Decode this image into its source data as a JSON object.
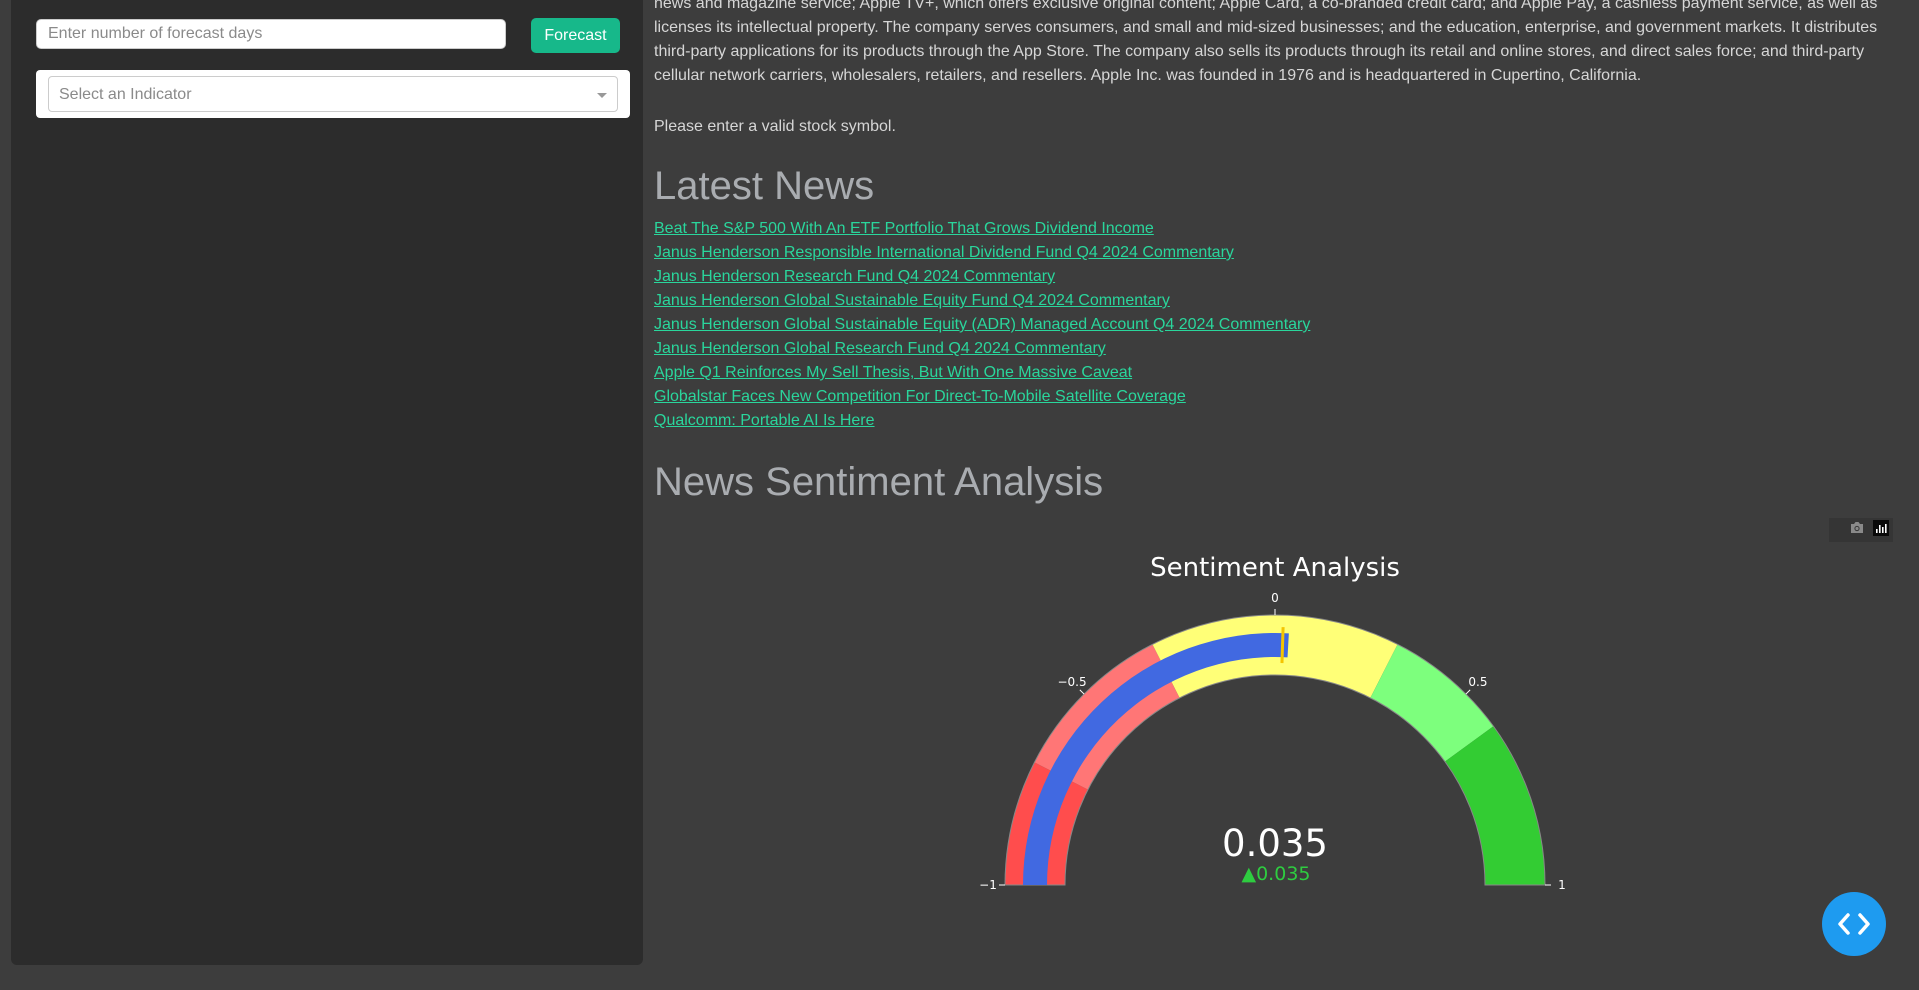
{
  "sidebar": {
    "forecast_placeholder": "Enter number of forecast days",
    "forecast_button": "Forecast",
    "indicator_placeholder": "Select an Indicator"
  },
  "main": {
    "description": "news and magazine service; Apple TV+, which offers exclusive original content; Apple Card, a co-branded credit card; and Apple Pay, a cashless payment service, as well as licenses its intellectual property. The company serves consumers, and small and mid-sized businesses; and the education, enterprise, and government markets. It distributes third-party applications for its products through the App Store. The company also sells its products through its retail and online stores, and direct sales force; and third-party cellular network carriers, wholesalers, retailers, and resellers. Apple Inc. was founded in 1976 and is headquartered in Cupertino, California.",
    "invalid_message": "Please enter a valid stock symbol.",
    "news_heading": "Latest News",
    "news": [
      "Beat The S&P 500 With An ETF Portfolio That Grows Dividend Income",
      "Janus Henderson Responsible International Dividend Fund Q4 2024 Commentary",
      "Janus Henderson Research Fund Q4 2024 Commentary",
      "Janus Henderson Global Sustainable Equity Fund Q4 2024 Commentary",
      "Janus Henderson Global Sustainable Equity (ADR) Managed Account Q4 2024 Commentary",
      "Janus Henderson Global Research Fund Q4 2024 Commentary",
      "Apple Q1 Reinforces My Sell Thesis, But With One Massive Caveat",
      "Globalstar Faces New Competition For Direct-To-Mobile Satellite Coverage",
      "Qualcomm: Portable AI Is Here"
    ],
    "sentiment_heading": "News Sentiment Analysis"
  },
  "modebar": {
    "icons": [
      "camera-icon",
      "plotly-logo-icon"
    ]
  },
  "fab": {
    "icon": "code-brackets-icon"
  },
  "chart_data": {
    "type": "gauge",
    "title": "Sentiment Analysis",
    "value": 0.035,
    "value_label": "0.035",
    "delta": 0.035,
    "delta_label": "▲0.035",
    "range": [
      -1,
      1
    ],
    "ticks": [
      -1,
      -0.5,
      0,
      0.5,
      1
    ],
    "tick_labels": [
      "−1",
      "−0.5",
      "0",
      "0.5",
      "1"
    ],
    "threshold": 0.02,
    "steps": [
      {
        "range": [
          -1,
          -0.7
        ],
        "color": "#ff4d4d"
      },
      {
        "range": [
          -0.7,
          -0.3
        ],
        "color": "#ff7676"
      },
      {
        "range": [
          -0.3,
          0.3
        ],
        "color": "#ffff77"
      },
      {
        "range": [
          0.3,
          0.6
        ],
        "color": "#7dff7d"
      },
      {
        "range": [
          0.6,
          1
        ],
        "color": "#33cc33"
      }
    ],
    "bar_color": "#4169e1",
    "threshold_color": "#f5c400",
    "delta_color": "#2ecc40"
  }
}
